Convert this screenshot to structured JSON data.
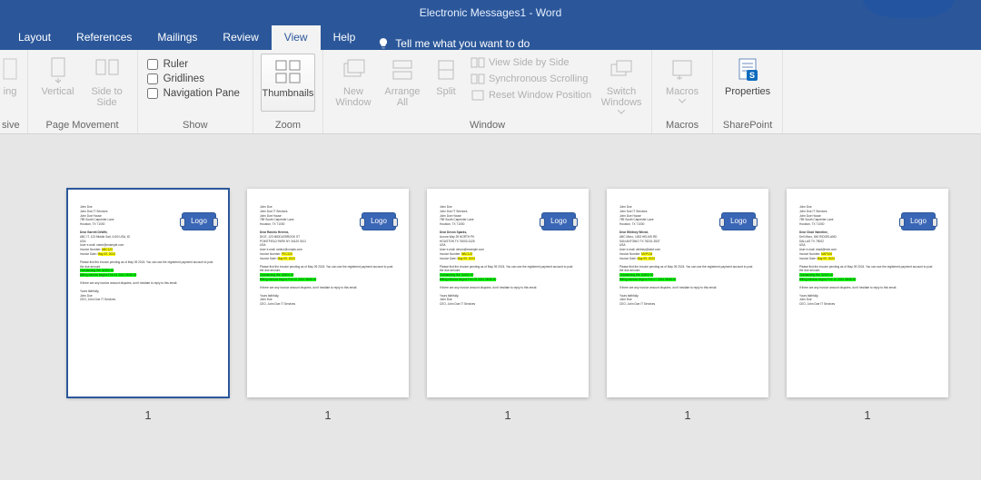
{
  "title": "Electronic Messages1  -  Word",
  "tabs": {
    "layout": "Layout",
    "references": "References",
    "mailings": "Mailings",
    "review": "Review",
    "view": "View",
    "help": "Help",
    "tellme": "Tell me what you want to do"
  },
  "ribbon": {
    "page_movement": {
      "vertical": "Vertical",
      "side_to_side": "Side to Side",
      "group": "Page Movement",
      "left_cut": "ing"
    },
    "show": {
      "ruler": "Ruler",
      "gridlines": "Gridlines",
      "nav": "Navigation Pane",
      "group": "Show"
    },
    "zoom": {
      "thumbnails": "Thumbnails",
      "group": "Zoom"
    },
    "window": {
      "new_window": "New Window",
      "arrange_all": "Arrange All",
      "split": "Split",
      "view_sbs": "View Side by Side",
      "sync": "Synchronous Scrolling",
      "reset": "Reset Window Position",
      "switch": "Switch Windows",
      "group": "Window"
    },
    "macros": {
      "label": "Macros",
      "group": "Macros"
    },
    "sharepoint": {
      "label": "Properties",
      "group": "SharePoint"
    }
  },
  "page_label": "1",
  "logo_text": "Logo",
  "pages": [
    {
      "header": [
        "John Doe",
        "John Doe IT Services",
        "John Doe House",
        "789 South Carpenter Lane",
        "Houston, TX 71000"
      ],
      "greeting": "Dear Garrett DeWitt,",
      "addr": [
        "ABC IT, 123 Middle Salt, 4100 USA, ID",
        "USA"
      ],
      "email": "User e-mail: name@example.com",
      "invoice_no_label": "Invoice Number:",
      "invoice_no": "ABC123",
      "invoice_date_label": "Invoice Date:",
      "invoice_date": "May 09, 2024",
      "body1": "Please find the invoice pending as of May 09 2024. You can use the registered payment account to post the due amount.",
      "outstanding_label": "Outstanding Bill:",
      "outstanding": "$2200.00",
      "deadline": "Billing window begins Feb 05 2024 08:55:00",
      "body2": "If there are any invoice amount disputes, don't hesitate to reply to this email.",
      "closing": [
        "Yours faithfully,",
        "John Doe",
        "CEO, John Doe IT Services"
      ]
    },
    {
      "header": [
        "John Doe",
        "John Doe IT Services",
        "John Doe House",
        "789 South Carpenter Lane",
        "Houston, TX 71000"
      ],
      "greeting": "Dear Ramiro Herrera,",
      "addr": [
        "DICE, 123 MIDDLEBROOK ST",
        "POINTFIELD PARK NY 34120 0101",
        "USA"
      ],
      "email": "User e-mail: ramiro@corpds.com",
      "invoice_no_label": "Invoice Number:",
      "invoice_no": "PEC220",
      "invoice_date_label": "Invoice Date:",
      "invoice_date": "May 09, 2024",
      "body1": "Please find the invoice pending as of May 09 2024. You can use the registered payment account to post the due amount.",
      "outstanding_label": "Outstanding Bill:",
      "outstanding": "$5400.00",
      "deadline": "Billing window begins Feb 02 2024 08:55:00",
      "body2": "If there are any invoice amount disputes, don't hesitate to reply to this email.",
      "closing": [
        "Yours faithfully,",
        "John Doe",
        "CEO, John Doe IT Services"
      ]
    },
    {
      "header": [
        "John Doe",
        "John Doe IT Services",
        "John Doe House",
        "789 South Carpenter Lane",
        "Houston, TX 71000"
      ],
      "greeting": "Dear Devon Sparks,",
      "addr": [
        "Aurora Way 39 NORTH PK",
        "HOUSTON TX 76003-3126",
        "USA"
      ],
      "email": "User e-mail: devon@example.com",
      "invoice_no_label": "Invoice Number:",
      "invoice_no": "NBC123",
      "invoice_date_label": "Invoice Date:",
      "invoice_date": "May 09, 2024",
      "body1": "Please find the invoice pending as of May 09 2024. You can use the registered payment account to post the due amount.",
      "outstanding_label": "Outstanding Bill:",
      "outstanding": "$4300.00",
      "deadline": "Billing window begins Feb 08 2024 08:55:00",
      "body2": "If there are any invoice amount disputes, don't hesitate to reply to this email.",
      "closing": [
        "Yours faithfully,",
        "John Doe",
        "CEO, John Doe IT Services"
      ]
    },
    {
      "header": [
        "John Doe",
        "John Doe IT Services",
        "John Doe House",
        "789 South Carpenter Lane",
        "Houston, TX 71000"
      ],
      "greeting": "Dear Whitney Wheat,",
      "addr": [
        "ABC Micro, 1453 HELMS RD",
        "SAN ANTONIO TX 78201-3537",
        "USA"
      ],
      "email": "User e-mail: whitney@abcf.com",
      "invoice_no_label": "Invoice Number:",
      "invoice_no": "MVP104",
      "invoice_date_label": "Invoice Date:",
      "invoice_date": "May 09, 2024",
      "body1": "Please find the invoice pending as of May 09 2024. You can use the registered payment account to post the due amount.",
      "outstanding_label": "Outstanding Bill:",
      "outstanding": "$3400.00",
      "deadline": "Billing window begins Feb 07 2024 08:55:00",
      "body2": "If there are any invoice amount disputes, don't hesitate to reply to this email.",
      "closing": [
        "Yours faithfully,",
        "John Doe",
        "CEO, John Doe IT Services"
      ]
    },
    {
      "header": [
        "John Doe",
        "John Doe IT Services",
        "John Doe House",
        "789 South Carpenter Lane",
        "Houston, TX 71000"
      ],
      "greeting": "Dear Chad Valentine,",
      "addr": [
        "Dell Micro, 840 RIDGELAND",
        "DALLAS TX 75002",
        "USA"
      ],
      "email": "User e-mail: chad@micr.com",
      "invoice_no_label": "Invoice Number:",
      "invoice_no": "NAP106",
      "invoice_date_label": "Invoice Date:",
      "invoice_date": "May 09, 2024",
      "body1": "Please find the invoice pending as of May 09 2024. You can use the registered payment account to post the due amount.",
      "outstanding_label": "Outstanding Bill:",
      "outstanding": "$2200.00",
      "deadline": "Billing window begins Feb 10 2024 08:55:00",
      "body2": "If there are any invoice amount disputes, don't hesitate to reply to this email.",
      "closing": [
        "Yours faithfully,",
        "John Doe",
        "CEO, John Doe IT Services"
      ]
    }
  ]
}
